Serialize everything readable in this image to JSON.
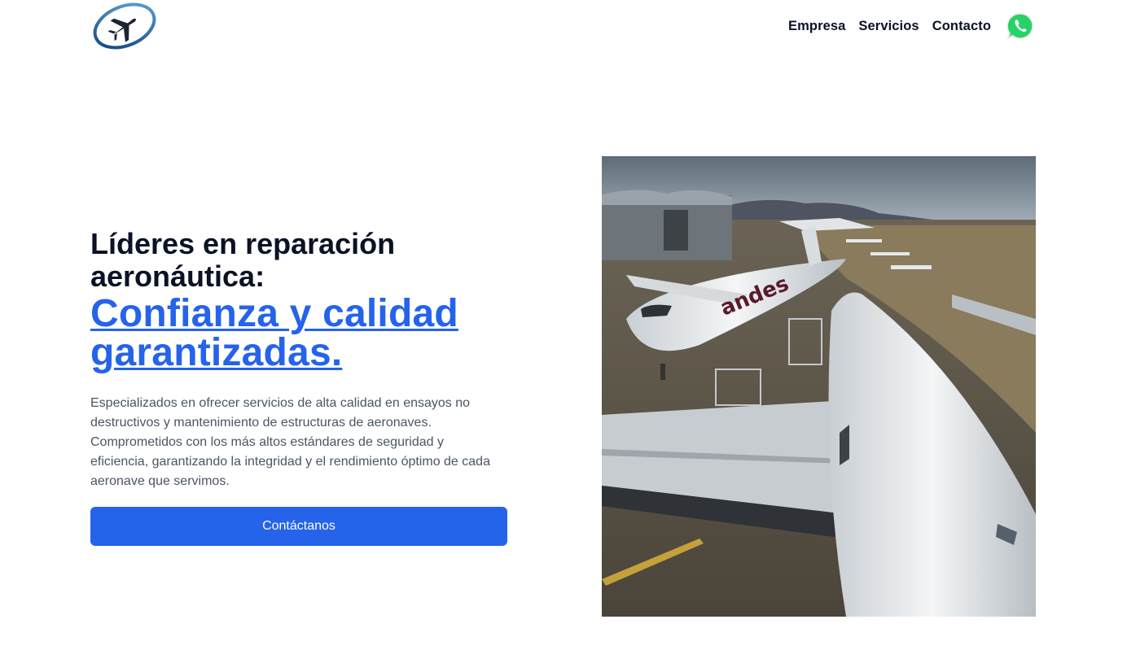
{
  "header": {
    "logo_icon": "airplane-orbit-logo",
    "nav": [
      {
        "label": "Empresa"
      },
      {
        "label": "Servicios"
      },
      {
        "label": "Contacto"
      }
    ],
    "whatsapp_icon": "whatsapp-icon"
  },
  "hero": {
    "title_line1": "Líderes en reparación",
    "title_line2": "aeronáutica:",
    "accent_line1": "Confianza y calidad",
    "accent_line2": "garantizadas.",
    "description": "Especializados en ofrecer servicios de alta calidad en ensayos no destructivos y mantenimiento de estructuras de aeronaves. Comprometidos con los más altos estándares de seguridad y eficiencia, garantizando la integridad y el rendimiento óptimo de cada aeronave que servimos.",
    "cta_label": "Contáctanos"
  },
  "image": {
    "livery_text": "andes"
  },
  "colors": {
    "accent": "#2563eb",
    "heading": "#0b1226",
    "body_text": "#4b5563",
    "whatsapp": "#25d366"
  }
}
